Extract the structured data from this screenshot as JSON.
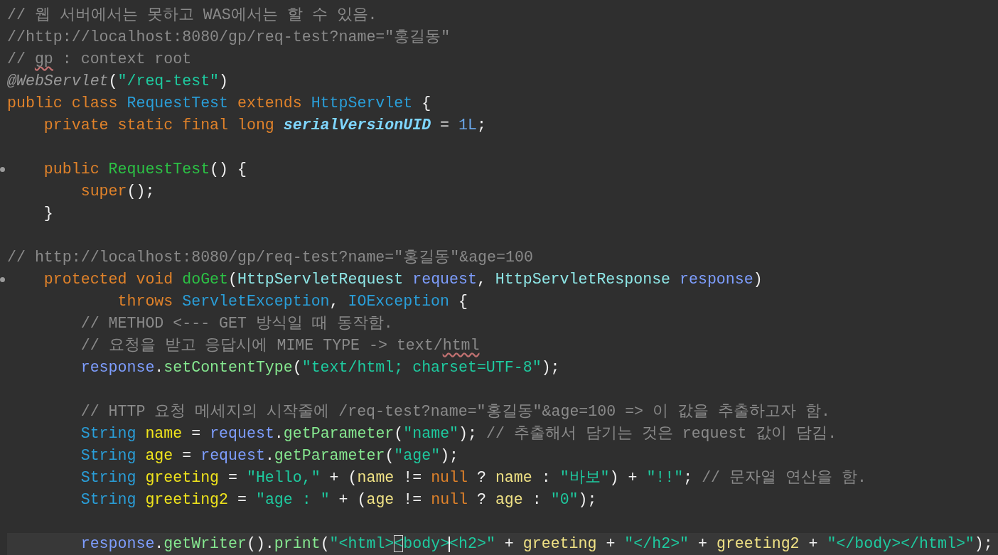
{
  "editor": {
    "lines": [
      {
        "kind": "code",
        "tokens": [
          {
            "kind": "comment",
            "text": "// 웹 서버에서는 못하고 WAS에서는 할 수 있음."
          }
        ]
      },
      {
        "kind": "code",
        "tokens": [
          {
            "kind": "comment",
            "text": "//http://localhost:8080/gp/req-test?name=\"홍길동\""
          }
        ]
      },
      {
        "kind": "code",
        "tokens": [
          {
            "kind": "comment",
            "text": "// "
          },
          {
            "kind": "comment",
            "text": "gp",
            "spelling_error": true
          },
          {
            "kind": "comment",
            "text": " : context root"
          }
        ]
      },
      {
        "kind": "code",
        "tokens": [
          {
            "kind": "annotation",
            "text": "@WebServlet"
          },
          {
            "kind": "plain",
            "text": "("
          },
          {
            "kind": "string",
            "text": "\"/req-test\""
          },
          {
            "kind": "plain",
            "text": ")"
          }
        ]
      },
      {
        "kind": "code",
        "tokens": [
          {
            "kind": "keyword",
            "text": "public class "
          },
          {
            "kind": "type",
            "text": "RequestTest"
          },
          {
            "kind": "keyword",
            "text": " extends "
          },
          {
            "kind": "type",
            "text": "HttpServlet"
          },
          {
            "kind": "plain",
            "text": " {"
          }
        ]
      },
      {
        "kind": "code",
        "tokens": [
          {
            "kind": "keyword",
            "text": "    private static final long "
          },
          {
            "kind": "constant",
            "text": "serialVersionUID"
          },
          {
            "kind": "plain",
            "text": " = "
          },
          {
            "kind": "number",
            "text": "1L"
          },
          {
            "kind": "plain",
            "text": ";"
          }
        ]
      },
      {
        "kind": "blank"
      },
      {
        "kind": "code",
        "fold": true,
        "tokens": [
          {
            "kind": "keyword",
            "text": "    public "
          },
          {
            "kind": "method-decl",
            "text": "RequestTest"
          },
          {
            "kind": "plain",
            "text": "() {"
          }
        ]
      },
      {
        "kind": "code",
        "tokens": [
          {
            "kind": "keyword",
            "text": "        super"
          },
          {
            "kind": "plain",
            "text": "();"
          }
        ]
      },
      {
        "kind": "code",
        "tokens": [
          {
            "kind": "plain",
            "text": "    }"
          }
        ]
      },
      {
        "kind": "blank"
      },
      {
        "kind": "code",
        "tokens": [
          {
            "kind": "comment",
            "text": "// http://localhost:8080/gp/req-test?name=\"홍길동\"&age=100"
          }
        ]
      },
      {
        "kind": "code",
        "fold": true,
        "tokens": [
          {
            "kind": "keyword",
            "text": "    protected void "
          },
          {
            "kind": "method-decl",
            "text": "doGet"
          },
          {
            "kind": "plain",
            "text": "("
          },
          {
            "kind": "param-type",
            "text": "HttpServletRequest"
          },
          {
            "kind": "param",
            "text": " request"
          },
          {
            "kind": "plain",
            "text": ", "
          },
          {
            "kind": "param-type",
            "text": "HttpServletResponse"
          },
          {
            "kind": "param",
            "text": " response"
          },
          {
            "kind": "plain",
            "text": ")"
          }
        ]
      },
      {
        "kind": "code",
        "tokens": [
          {
            "kind": "keyword",
            "text": "            throws "
          },
          {
            "kind": "type",
            "text": "ServletException"
          },
          {
            "kind": "plain",
            "text": ", "
          },
          {
            "kind": "type",
            "text": "IOException"
          },
          {
            "kind": "plain",
            "text": " {"
          }
        ]
      },
      {
        "kind": "code",
        "tokens": [
          {
            "kind": "comment",
            "text": "        // METHOD <--- GET 방식일 때 동작함."
          }
        ]
      },
      {
        "kind": "code",
        "tokens": [
          {
            "kind": "comment",
            "text": "        // 요청을 받고 응답시에 MIME TYPE -> text/"
          },
          {
            "kind": "comment",
            "text": "html",
            "spelling_error": true
          }
        ]
      },
      {
        "kind": "code",
        "tokens": [
          {
            "kind": "param",
            "text": "        response"
          },
          {
            "kind": "plain",
            "text": "."
          },
          {
            "kind": "method",
            "text": "setContentType"
          },
          {
            "kind": "plain",
            "text": "("
          },
          {
            "kind": "string",
            "text": "\"text/html; charset=UTF-8\""
          },
          {
            "kind": "plain",
            "text": ");"
          }
        ]
      },
      {
        "kind": "blank"
      },
      {
        "kind": "code",
        "tokens": [
          {
            "kind": "comment",
            "text": "        // HTTP 요청 메세지의 시작줄에 /req-test?name=\"홍길동\"&age=100 => 이 값을 추출하고자 함."
          }
        ]
      },
      {
        "kind": "code",
        "tokens": [
          {
            "kind": "type",
            "text": "        String "
          },
          {
            "kind": "variable",
            "text": "name"
          },
          {
            "kind": "plain",
            "text": " = "
          },
          {
            "kind": "param",
            "text": "request"
          },
          {
            "kind": "plain",
            "text": "."
          },
          {
            "kind": "method",
            "text": "getParameter"
          },
          {
            "kind": "plain",
            "text": "("
          },
          {
            "kind": "string",
            "text": "\"name\""
          },
          {
            "kind": "plain",
            "text": "); "
          },
          {
            "kind": "comment",
            "text": "// 추출해서 담기는 것은 request 값이 담김."
          }
        ]
      },
      {
        "kind": "code",
        "tokens": [
          {
            "kind": "type",
            "text": "        String "
          },
          {
            "kind": "variable",
            "text": "age"
          },
          {
            "kind": "plain",
            "text": " = "
          },
          {
            "kind": "param",
            "text": "request"
          },
          {
            "kind": "plain",
            "text": "."
          },
          {
            "kind": "method",
            "text": "getParameter"
          },
          {
            "kind": "plain",
            "text": "("
          },
          {
            "kind": "string",
            "text": "\"age\""
          },
          {
            "kind": "plain",
            "text": ");"
          }
        ]
      },
      {
        "kind": "code",
        "tokens": [
          {
            "kind": "type",
            "text": "        String "
          },
          {
            "kind": "variable",
            "text": "greeting"
          },
          {
            "kind": "plain",
            "text": " = "
          },
          {
            "kind": "string",
            "text": "\"Hello,\""
          },
          {
            "kind": "plain",
            "text": " + ("
          },
          {
            "kind": "variable-ref",
            "text": "name"
          },
          {
            "kind": "plain",
            "text": " != "
          },
          {
            "kind": "keyword",
            "text": "null"
          },
          {
            "kind": "plain",
            "text": " ? "
          },
          {
            "kind": "variable-ref",
            "text": "name"
          },
          {
            "kind": "plain",
            "text": " : "
          },
          {
            "kind": "string",
            "text": "\"바보\""
          },
          {
            "kind": "plain",
            "text": ") + "
          },
          {
            "kind": "string",
            "text": "\"!!\""
          },
          {
            "kind": "plain",
            "text": "; "
          },
          {
            "kind": "comment",
            "text": "// 문자열 연산을 함."
          }
        ]
      },
      {
        "kind": "code",
        "tokens": [
          {
            "kind": "type",
            "text": "        String "
          },
          {
            "kind": "variable",
            "text": "greeting2"
          },
          {
            "kind": "plain",
            "text": " = "
          },
          {
            "kind": "string",
            "text": "\"age : \""
          },
          {
            "kind": "plain",
            "text": " + ("
          },
          {
            "kind": "variable-ref",
            "text": "age"
          },
          {
            "kind": "plain",
            "text": " != "
          },
          {
            "kind": "keyword",
            "text": "null"
          },
          {
            "kind": "plain",
            "text": " ? "
          },
          {
            "kind": "variable-ref",
            "text": "age"
          },
          {
            "kind": "plain",
            "text": " : "
          },
          {
            "kind": "string",
            "text": "\"0\""
          },
          {
            "kind": "plain",
            "text": ");"
          }
        ]
      },
      {
        "kind": "blank"
      },
      {
        "kind": "code",
        "current": true,
        "tokens": [
          {
            "kind": "param",
            "text": "        response"
          },
          {
            "kind": "plain",
            "text": "."
          },
          {
            "kind": "method",
            "text": "getWriter"
          },
          {
            "kind": "plain",
            "text": "()."
          },
          {
            "kind": "method",
            "text": "print"
          },
          {
            "kind": "plain",
            "text": "("
          },
          {
            "kind": "string",
            "text": "\"<html>"
          },
          {
            "kind": "string",
            "text": "<",
            "bracket_match": true
          },
          {
            "kind": "string",
            "text": "body>",
            "cursor_after": true
          },
          {
            "kind": "string",
            "text": "<h2>\""
          },
          {
            "kind": "plain",
            "text": " + "
          },
          {
            "kind": "variable-ref",
            "text": "greeting"
          },
          {
            "kind": "plain",
            "text": " + "
          },
          {
            "kind": "string",
            "text": "\"</h2>\""
          },
          {
            "kind": "plain",
            "text": " + "
          },
          {
            "kind": "variable-ref",
            "text": "greeting2"
          },
          {
            "kind": "plain",
            "text": " + "
          },
          {
            "kind": "string",
            "text": "\"</body></html>\""
          },
          {
            "kind": "plain",
            "text": ");"
          }
        ]
      }
    ]
  }
}
